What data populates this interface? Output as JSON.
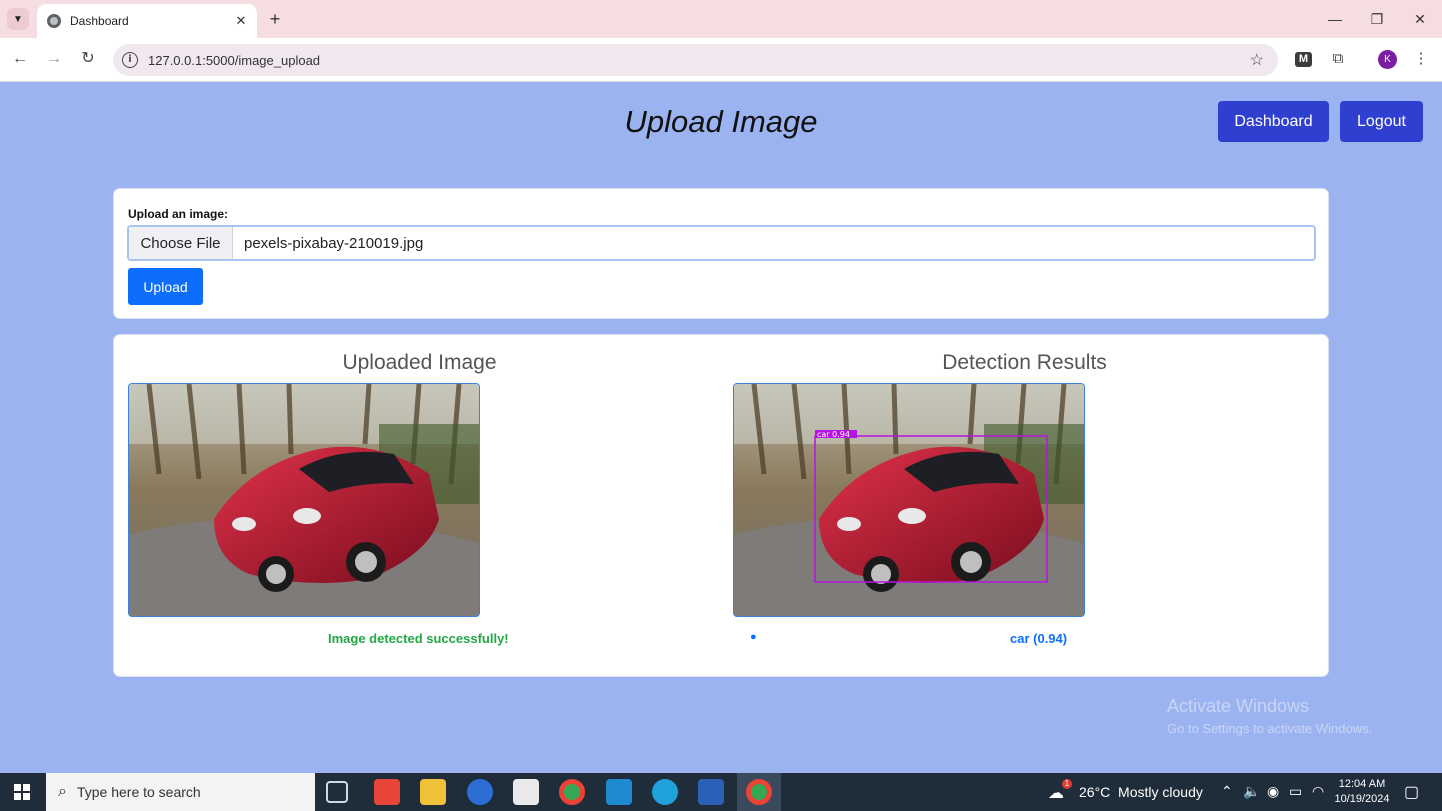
{
  "browser": {
    "tab_title": "Dashboard",
    "url": "127.0.0.1:5000/image_upload",
    "profile_initial": "K",
    "toolbar_ext_letter": "M"
  },
  "header": {
    "title": "Upload Image",
    "dashboard_label": "Dashboard",
    "logout_label": "Logout"
  },
  "upload_form": {
    "label": "Upload an image:",
    "choose_file_label": "Choose File",
    "file_name": "pexels-pixabay-210019.jpg",
    "upload_label": "Upload"
  },
  "results": {
    "uploaded_title": "Uploaded Image",
    "detection_title": "Detection Results",
    "status_message": "Image detected successfully!",
    "detections": [
      {
        "label": "car (0.94)",
        "box_tag": "car 0.94"
      }
    ]
  },
  "watermark": {
    "line1": "Activate Windows",
    "line2": "Go to Settings to activate Windows."
  },
  "taskbar": {
    "search_placeholder": "Type here to search",
    "weather": "26°C  Mostly cloudy",
    "time": "12:04 AM",
    "date": "10/19/2024",
    "weather_badge": "1"
  },
  "colors": {
    "page_bg": "#9bb3f0",
    "header_button": "#2f3fcf",
    "primary": "#0d6efd",
    "success": "#22a845",
    "detection_box": "#b515e0"
  }
}
